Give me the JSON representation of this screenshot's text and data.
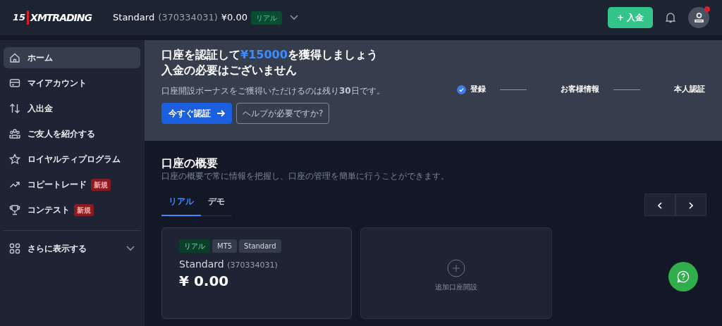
{
  "header": {
    "logo_number": "15",
    "logo_text": "XMTRADING",
    "account": {
      "type": "Standard",
      "number": "(370334031)",
      "balance": "¥0.00",
      "badge": "リアル"
    },
    "deposit_button": "+ 入金",
    "notification": true
  },
  "sidebar": {
    "items": [
      {
        "kind": "home",
        "label": "ホーム",
        "selected": true
      },
      {
        "kind": "card",
        "label": "マイアカウント",
        "selected": false
      },
      {
        "kind": "transfer",
        "label": "入出金",
        "selected": false
      },
      {
        "kind": "people",
        "label": "ご友人を紹介する",
        "selected": false
      },
      {
        "kind": "star",
        "label": "ロイヤルティプログラム",
        "selected": false
      },
      {
        "kind": "trend",
        "label": "コピートレード",
        "badge": "新規",
        "selected": false
      },
      {
        "kind": "trophy",
        "label": "コンテスト",
        "badge": "新規",
        "selected": false
      }
    ],
    "more": {
      "label": "さらに表示する",
      "expanded": false
    }
  },
  "banner": {
    "title_lines": [
      "口座を認証して**¥15000**を獲得しましょう",
      "入金の必要はございません"
    ],
    "note": "口座開設ボーナスをご獲得いただけるのは残り**30**日です。",
    "primary_button": "今すぐ認証",
    "secondary_button": "ヘルプが必要ですか?",
    "steps": [
      {
        "label": "登録",
        "done": true
      },
      {
        "label": "お客様情報",
        "done": false
      },
      {
        "label": "本人認証",
        "done": false
      }
    ]
  },
  "overview": {
    "title": "口座の概要",
    "subtitle": "口座の概要で常に情報を把握し、口座の管理を簡単に行うことができます。",
    "tabs": [
      {
        "label": "リアル",
        "selected": true
      },
      {
        "label": "デモ",
        "selected": false
      }
    ],
    "account_card": {
      "tags": [
        {
          "label": "リアル",
          "kind": "real"
        },
        {
          "label": "MT5",
          "kind": "plain"
        },
        {
          "label": "Standard",
          "kind": "plain"
        }
      ],
      "name": "Standard",
      "number": "(370334031)",
      "balance": "¥ 0.00"
    },
    "add_card": {
      "label": "追加口座開設"
    }
  }
}
